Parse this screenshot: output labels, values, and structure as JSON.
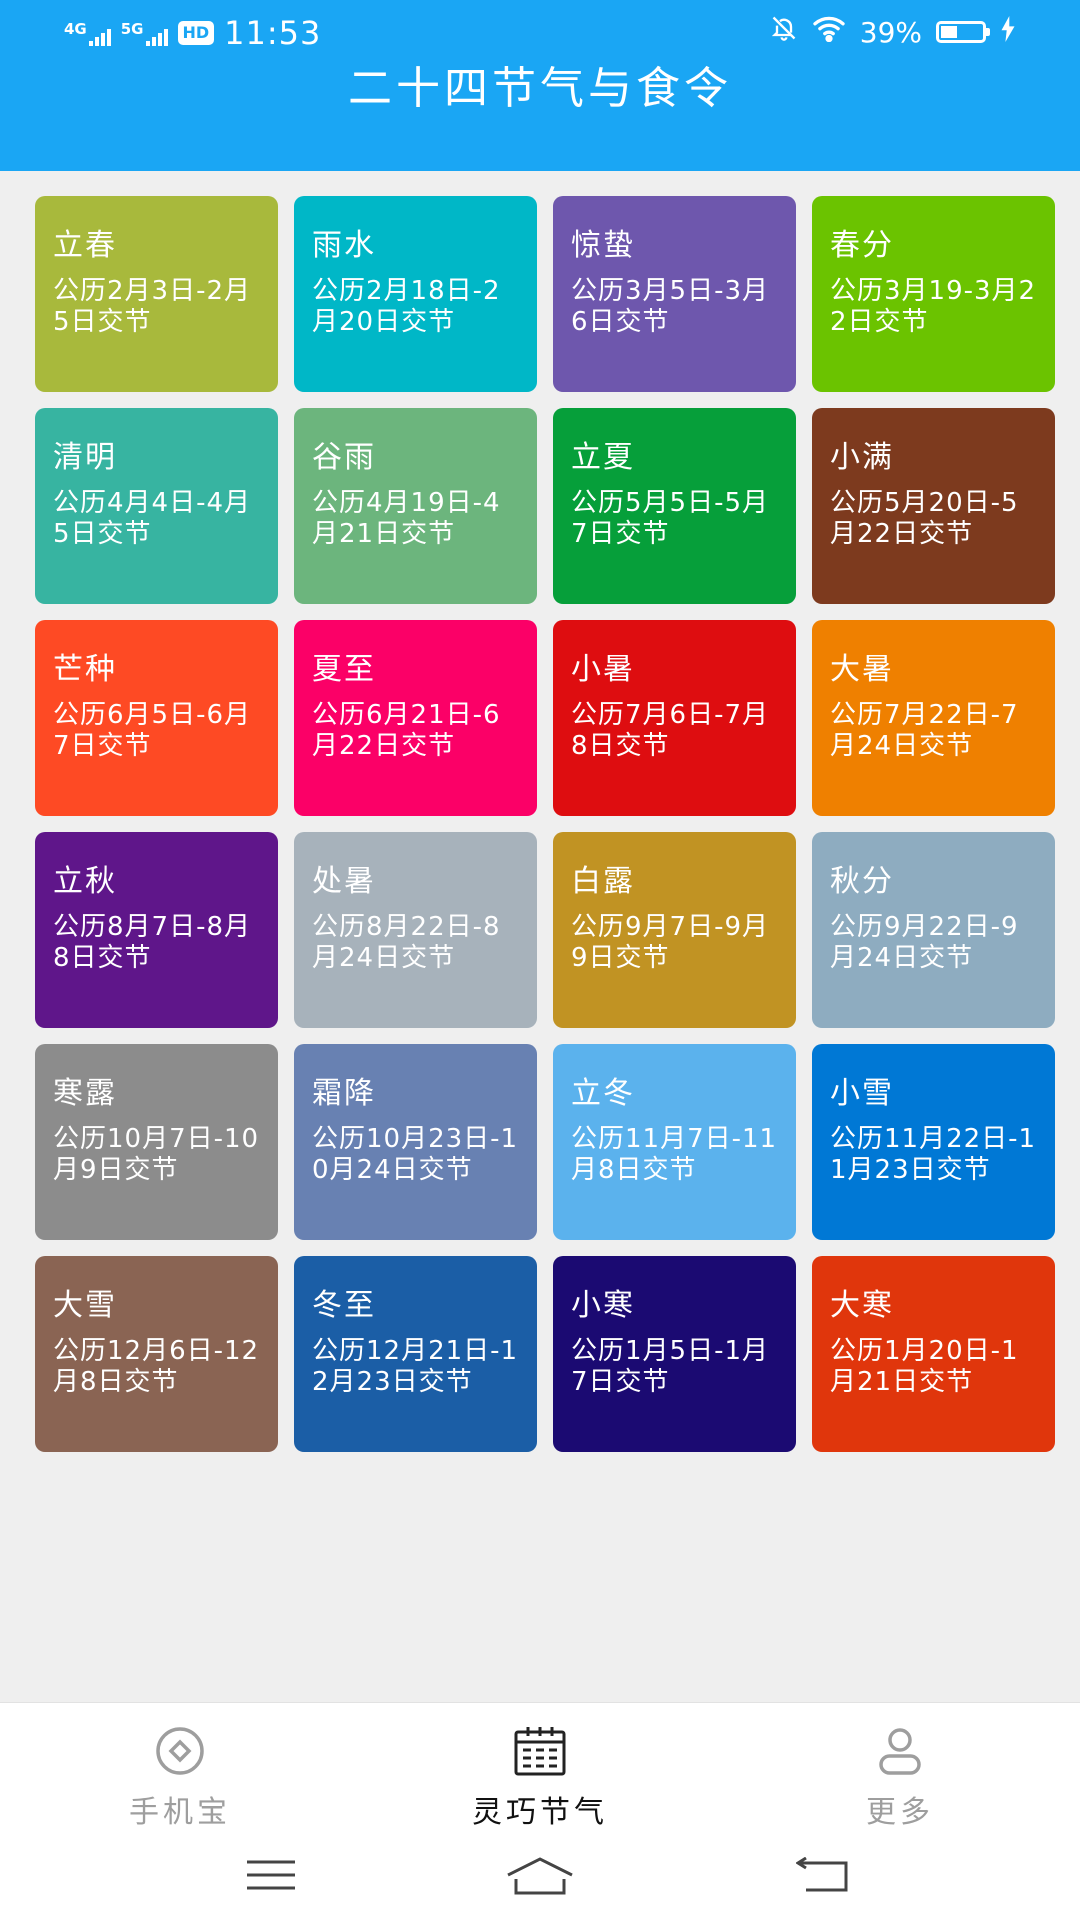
{
  "status_bar": {
    "network_1": "4G",
    "network_2": "5G",
    "hd_badge": "HD",
    "time": "11:53",
    "battery_percent": "39%",
    "battery_level": 0.39,
    "icons": [
      "signal-icon",
      "hd-icon",
      "bell-off-icon",
      "wifi-icon",
      "battery-icon",
      "charging-icon"
    ]
  },
  "header": {
    "title": "二十四节气与食令"
  },
  "colors": {
    "header_bg": "#1aa6f4",
    "page_bg": "#efefef",
    "nav_active": "#111111",
    "nav_inactive": "#9e9e9e"
  },
  "terms": [
    {
      "name": "立春",
      "desc": "公历2月3日-2月5日交节",
      "color": "#a8b93c"
    },
    {
      "name": "雨水",
      "desc": "公历2月18日-2月20日交节",
      "color": "#00b7c7"
    },
    {
      "name": "惊蛰",
      "desc": "公历3月5日-3月6日交节",
      "color": "#6e57ad"
    },
    {
      "name": "春分",
      "desc": "公历3月19-3月22日交节",
      "color": "#6bc300"
    },
    {
      "name": "清明",
      "desc": "公历4月4日-4月5日交节",
      "color": "#37b4a1"
    },
    {
      "name": "谷雨",
      "desc": "公历4月19日-4月21日交节",
      "color": "#6cb57d"
    },
    {
      "name": "立夏",
      "desc": "公历5月5日-5月7日交节",
      "color": "#069f3a"
    },
    {
      "name": "小满",
      "desc": "公历5月20日-5月22日交节",
      "color": "#7d3a1e"
    },
    {
      "name": "芒种",
      "desc": "公历6月5日-6月7日交节",
      "color": "#fe4a24"
    },
    {
      "name": "夏至",
      "desc": "公历6月21日-6月22日交节",
      "color": "#fb0067"
    },
    {
      "name": "小暑",
      "desc": "公历7月6日-7月8日交节",
      "color": "#de0d10"
    },
    {
      "name": "大暑",
      "desc": "公历7月22日-7月24日交节",
      "color": "#ef8000"
    },
    {
      "name": "立秋",
      "desc": "公历8月7日-8月8日交节",
      "color": "#5f168a"
    },
    {
      "name": "处暑",
      "desc": "公历8月22日-8月24日交节",
      "color": "#a7b2bb"
    },
    {
      "name": "白露",
      "desc": "公历9月7日-9月9日交节",
      "color": "#c19323"
    },
    {
      "name": "秋分",
      "desc": "公历9月22日-9月24日交节",
      "color": "#8eacc0"
    },
    {
      "name": "寒露",
      "desc": "公历10月7日-10月9日交节",
      "color": "#8c8c8c"
    },
    {
      "name": "霜降",
      "desc": "公历10月23日-10月24日交节",
      "color": "#6881b2"
    },
    {
      "name": "立冬",
      "desc": "公历11月7日-11月8日交节",
      "color": "#5bb2ed"
    },
    {
      "name": "小雪",
      "desc": "公历11月22日-11月23日交节",
      "color": "#0078d5"
    },
    {
      "name": "大雪",
      "desc": "公历12月6日-12月8日交节",
      "color": "#8a6453"
    },
    {
      "name": "冬至",
      "desc": "公历12月21日-12月23日交节",
      "color": "#1b5ea6"
    },
    {
      "name": "小寒",
      "desc": "公历1月5日-1月7日交节",
      "color": "#1b0a72"
    },
    {
      "name": "大寒",
      "desc": "公历1月20日-1月21日交节",
      "color": "#e0360c"
    }
  ],
  "bottom_nav": {
    "items": [
      {
        "label": "手机宝",
        "icon": "diamond-circle-icon",
        "active": false
      },
      {
        "label": "灵巧节气",
        "icon": "calendar-icon",
        "active": true
      },
      {
        "label": "更多",
        "icon": "user-icon",
        "active": false
      }
    ]
  },
  "system_nav": {
    "icons": [
      "menu-icon",
      "home-icon",
      "back-icon"
    ]
  }
}
